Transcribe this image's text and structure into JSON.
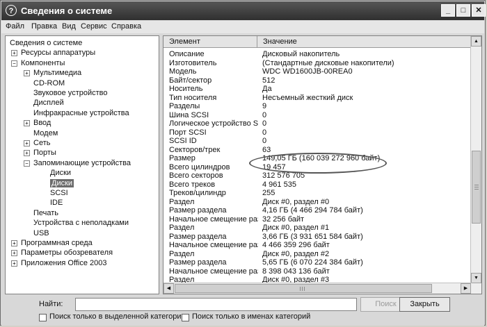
{
  "window": {
    "title": "Сведения о системе",
    "controls": {
      "minimize": "_",
      "maximize": "□",
      "close": "✕"
    }
  },
  "menubar": [
    "Файл",
    "Правка",
    "Вид",
    "Сервис",
    "Справка"
  ],
  "tree": [
    {
      "label": "Сведения о системе",
      "level": 0,
      "toggle": ""
    },
    {
      "label": "Ресурсы аппаратуры",
      "level": 1,
      "toggle": "+"
    },
    {
      "label": "Компоненты",
      "level": 1,
      "toggle": "−"
    },
    {
      "label": "Мультимедиа",
      "level": 2,
      "toggle": "+"
    },
    {
      "label": "CD-ROM",
      "level": 2,
      "toggle": ""
    },
    {
      "label": "Звуковое устройство",
      "level": 2,
      "toggle": ""
    },
    {
      "label": "Дисплей",
      "level": 2,
      "toggle": ""
    },
    {
      "label": "Инфракрасные устройства",
      "level": 2,
      "toggle": ""
    },
    {
      "label": "Ввод",
      "level": 2,
      "toggle": "+"
    },
    {
      "label": "Модем",
      "level": 2,
      "toggle": ""
    },
    {
      "label": "Сеть",
      "level": 2,
      "toggle": "+"
    },
    {
      "label": "Порты",
      "level": 2,
      "toggle": "+"
    },
    {
      "label": "Запоминающие устройства",
      "level": 2,
      "toggle": "−"
    },
    {
      "label": "Диски",
      "level": 3,
      "toggle": ""
    },
    {
      "label": "Диски",
      "level": 3,
      "toggle": "",
      "selected": true
    },
    {
      "label": "SCSI",
      "level": 3,
      "toggle": ""
    },
    {
      "label": "IDE",
      "level": 3,
      "toggle": ""
    },
    {
      "label": "Печать",
      "level": 2,
      "toggle": ""
    },
    {
      "label": "Устройства с неполадками",
      "level": 2,
      "toggle": ""
    },
    {
      "label": "USB",
      "level": 2,
      "toggle": ""
    },
    {
      "label": "Программная среда",
      "level": 1,
      "toggle": "+"
    },
    {
      "label": "Параметры обозревателя",
      "level": 1,
      "toggle": "+"
    },
    {
      "label": "Приложения Office 2003",
      "level": 1,
      "toggle": "+"
    }
  ],
  "table": {
    "columns": [
      "Элемент",
      "Значение"
    ],
    "rows": [
      [
        "Описание",
        "Дисковый накопитель"
      ],
      [
        "Изготовитель",
        "(Стандартные дисковые накопители)"
      ],
      [
        "Модель",
        "WDC WD1600JB-00REA0"
      ],
      [
        "Байт/сектор",
        "512"
      ],
      [
        "Носитель",
        "Да"
      ],
      [
        "Тип носителя",
        "Несъемный жесткий диск"
      ],
      [
        "Разделы",
        "9"
      ],
      [
        "Шина SCSI",
        "0"
      ],
      [
        "Логическое устройство S...",
        "0"
      ],
      [
        "Порт SCSI",
        "0"
      ],
      [
        "SCSI ID",
        "0"
      ],
      [
        "Секторов/трек",
        "63"
      ],
      [
        "Размер",
        "149,05 ГБ (160 039 272 960 байт)"
      ],
      [
        "Всего цилиндров",
        "19 457"
      ],
      [
        "Всего секторов",
        "312 576 705"
      ],
      [
        "Всего треков",
        "4 961 535"
      ],
      [
        "Треков/цилиндр",
        "255"
      ],
      [
        "Раздел",
        "Диск #0, раздел #0"
      ],
      [
        "Размер раздела",
        "4,16 ГБ (4 466 294 784 байт)"
      ],
      [
        "Начальное смещение раз...",
        "32 256 байт"
      ],
      [
        "Раздел",
        "Диск #0, раздел #1"
      ],
      [
        "Размер раздела",
        "3,66 ГБ (3 931 651 584 байт)"
      ],
      [
        "Начальное смещение раз...",
        "4 466 359 296 байт"
      ],
      [
        "Раздел",
        "Диск #0, раздел #2"
      ],
      [
        "Размер раздела",
        "5,65 ГБ (6 070 224 384 байт)"
      ],
      [
        "Начальное смещение раз...",
        "8 398 043 136 байт"
      ],
      [
        "Раздел",
        "Диск #0, раздел #3"
      ]
    ]
  },
  "search": {
    "label": "Найти:",
    "value": "",
    "find_button": "Поиск",
    "close_button": "Закрыть",
    "option_selected_category": "Поиск только в выделенной категории",
    "option_category_names": "Поиск только в именах категорий"
  }
}
